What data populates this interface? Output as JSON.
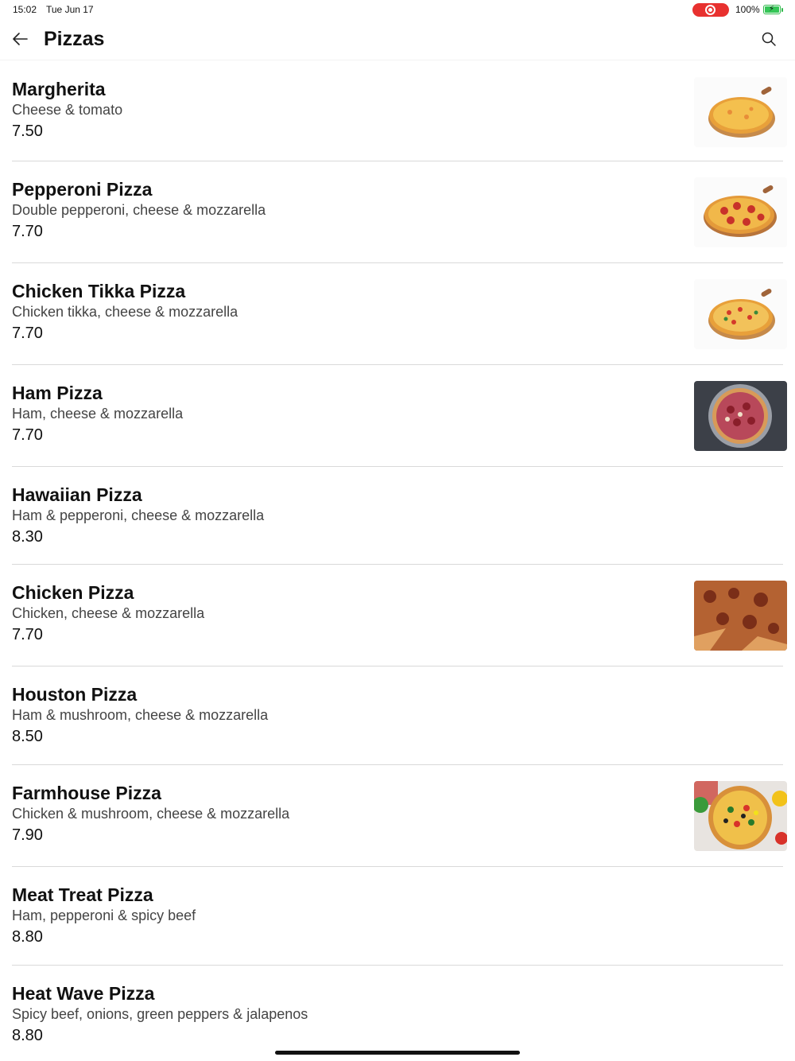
{
  "status_bar": {
    "time": "15:02",
    "date": "Tue Jun 17",
    "battery_percent": "100%",
    "recording_color": "#e8312f",
    "battery_color": "#35c657"
  },
  "app_bar": {
    "title": "Pizzas",
    "back_icon": "arrow-left-icon",
    "search_icon": "search-icon"
  },
  "items": [
    {
      "name": "Margherita",
      "description": "Cheese & tomato",
      "price": "7.50",
      "image": "margherita-pizza-on-board"
    },
    {
      "name": "Pepperoni Pizza",
      "description": "Double pepperoni, cheese & mozzarella",
      "price": "7.70",
      "image": "pepperoni-pizza-on-board"
    },
    {
      "name": "Chicken Tikka Pizza",
      "description": "Chicken tikka, cheese & mozzarella",
      "price": "7.70",
      "image": "chicken-tikka-pizza-on-board"
    },
    {
      "name": "Ham Pizza",
      "description": "Ham, cheese & mozzarella",
      "price": "7.70",
      "image": "ham-pizza-on-dark-table"
    },
    {
      "name": "Hawaiian Pizza",
      "description": "Ham & pepperoni, cheese & mozzarella",
      "price": "8.30",
      "image": ""
    },
    {
      "name": "Chicken Pizza",
      "description": "Chicken, cheese & mozzarella",
      "price": "7.70",
      "image": "chicken-pizza-slices"
    },
    {
      "name": "Houston Pizza",
      "description": "Ham & mushroom, cheese & mozzarella",
      "price": "8.50",
      "image": ""
    },
    {
      "name": "Farmhouse Pizza",
      "description": "Chicken & mushroom, cheese & mozzarella",
      "price": "7.90",
      "image": "farmhouse-pizza-with-vegetables"
    },
    {
      "name": "Meat Treat Pizza",
      "description": "Ham, pepperoni & spicy beef",
      "price": "8.80",
      "image": ""
    },
    {
      "name": "Heat Wave Pizza",
      "description": "Spicy beef, onions, green peppers & jalapenos",
      "price": "8.80",
      "image": ""
    }
  ]
}
